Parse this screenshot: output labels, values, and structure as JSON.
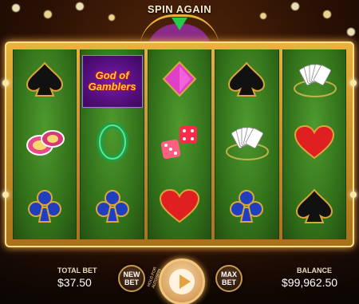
{
  "header": {
    "spin_again": "SPIN AGAIN"
  },
  "reels": [
    [
      "spade",
      "chips",
      "club"
    ],
    [
      "logo",
      "bangle",
      "club"
    ],
    [
      "diamond",
      "dice",
      "heart"
    ],
    [
      "spade",
      "cards",
      "club"
    ],
    [
      "cards",
      "heart",
      "spade"
    ]
  ],
  "logo": {
    "line1": "God of",
    "line2": "Gamblers"
  },
  "footer": {
    "total_bet_label": "TOTAL BET",
    "total_bet_value": "$37.50",
    "new_bet_line1": "NEW",
    "new_bet_line2": "BET",
    "hold_text": "HOLD FOR AUTOSPIN",
    "max_bet_line1": "MAX",
    "max_bet_line2": "BET",
    "balance_label": "BALANCE",
    "balance_value": "$99,962.50"
  },
  "colors": {
    "felt": "#3f8524",
    "frame_gold": "#e9b33d",
    "accent_red": "#e02020",
    "suit_blue": "#1f3fbf"
  }
}
